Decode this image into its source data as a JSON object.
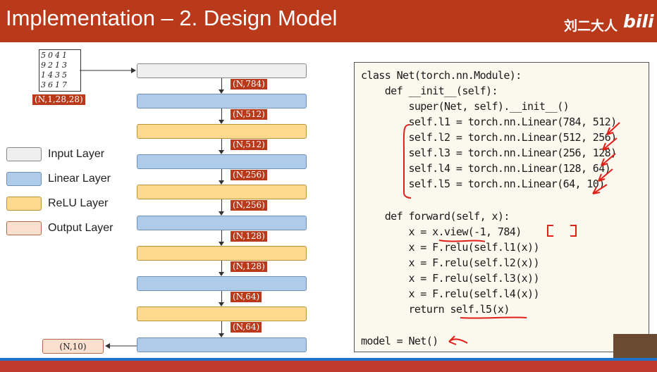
{
  "header": {
    "title": "Implementation – 2. Design Model",
    "logo_text": "刘二大人",
    "logo_brand": "bili"
  },
  "mnist": {
    "rows": [
      "5041",
      "9213",
      "1435",
      "3617"
    ],
    "shape_label": "(N,1,28,28)"
  },
  "layers": [
    {
      "type": "input",
      "out_dim": "(N,784)"
    },
    {
      "type": "linear",
      "out_dim": "(N,512)"
    },
    {
      "type": "relu",
      "out_dim": "(N,512)"
    },
    {
      "type": "linear",
      "out_dim": "(N,256)"
    },
    {
      "type": "relu",
      "out_dim": "(N,256)"
    },
    {
      "type": "linear",
      "out_dim": "(N,128)"
    },
    {
      "type": "relu",
      "out_dim": "(N,128)"
    },
    {
      "type": "linear",
      "out_dim": "(N,64)"
    },
    {
      "type": "relu",
      "out_dim": "(N,64)"
    },
    {
      "type": "linear",
      "out_dim": ""
    }
  ],
  "output_label": "(N,10)",
  "legend": [
    {
      "label": "Input Layer",
      "color": "#efefef"
    },
    {
      "label": "Linear Layer",
      "color": "#aecbea"
    },
    {
      "label": "ReLU Layer",
      "color": "#fcd98c"
    },
    {
      "label": "Output Layer",
      "color": "#fbe0d0"
    }
  ],
  "code": {
    "lines": [
      "class Net(torch.nn.Module):",
      "    def __init__(self):",
      "        super(Net, self).__init__()",
      "        self.l1 = torch.nn.Linear(784, 512)",
      "        self.l2 = torch.nn.Linear(512, 256)",
      "        self.l3 = torch.nn.Linear(256, 128)",
      "        self.l4 = torch.nn.Linear(128, 64)",
      "        self.l5 = torch.nn.Linear(64, 10)",
      "",
      "    def forward(self, x):",
      "        x = x.view(-1, 784)",
      "        x = F.relu(self.l1(x))",
      "        x = F.relu(self.l2(x))",
      "        x = F.relu(self.l3(x))",
      "        x = F.relu(self.l4(x))",
      "        return self.l5(x)",
      "",
      "model = Net()"
    ]
  },
  "colors": {
    "header_bg": "#b83a1b",
    "annotation_red": "#e0201a"
  }
}
